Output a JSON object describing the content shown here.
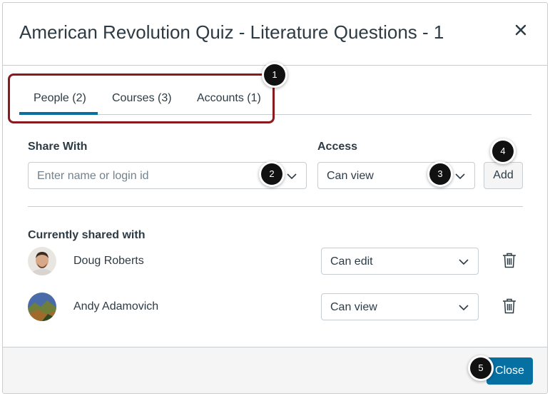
{
  "dialog": {
    "title": "American Revolution Quiz - Literature Questions - 1",
    "close_icon": "close-icon"
  },
  "tabs": [
    {
      "label": "People (2)",
      "active": true
    },
    {
      "label": "Courses (3)",
      "active": false
    },
    {
      "label": "Accounts (1)",
      "active": false
    }
  ],
  "share": {
    "share_with_label": "Share With",
    "name_placeholder": "Enter name or login id",
    "access_label": "Access",
    "access_value": "Can view",
    "add_label": "Add"
  },
  "shared": {
    "heading": "Currently shared with",
    "people": [
      {
        "name": "Doug Roberts",
        "access": "Can edit"
      },
      {
        "name": "Andy Adamovich",
        "access": "Can view"
      }
    ]
  },
  "footer": {
    "close_label": "Close"
  },
  "callouts": [
    "1",
    "2",
    "3",
    "4",
    "5"
  ],
  "colors": {
    "accent": "#0770a3",
    "highlight": "#8b1a1f",
    "text": "#2d3b45",
    "border": "#c7cdd1",
    "footer_bg": "#f5f5f5"
  }
}
